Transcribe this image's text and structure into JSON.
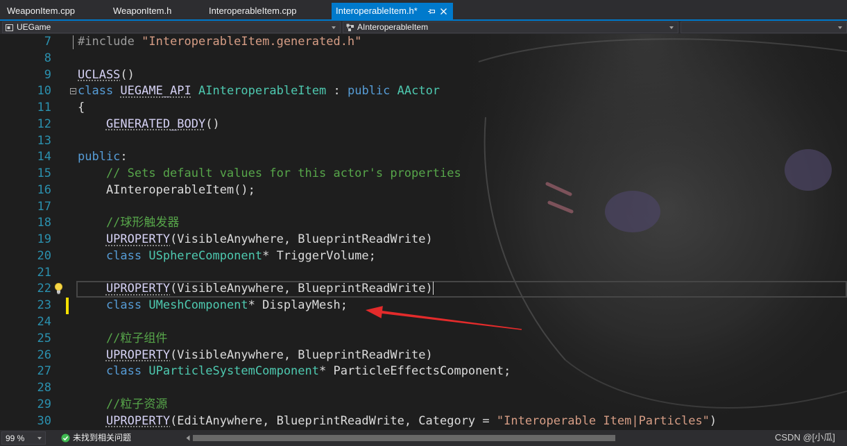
{
  "tabs": [
    {
      "label": "WeaponItem.cpp"
    },
    {
      "label": "WeaponItem.h"
    },
    {
      "label": "InteroperableItem.cpp"
    },
    {
      "label": "InteroperableItem.h*",
      "active": true
    }
  ],
  "nav": {
    "project": "UEGame",
    "scope": "AInteroperableItem"
  },
  "editor": {
    "lines": [
      {
        "number": "7",
        "outline": true,
        "tokens": [
          {
            "text": "#include ",
            "color": "#9b9b9b"
          },
          {
            "text": "\"InteroperableItem.generated.h\"",
            "color": "#d69d85"
          }
        ]
      },
      {
        "number": "8",
        "tokens": []
      },
      {
        "number": "9",
        "tokens": [
          {
            "text": "UCLASS",
            "color": "#d6d2f5",
            "underline": true
          },
          {
            "text": "()",
            "color": "#dcdcdc"
          }
        ]
      },
      {
        "number": "10",
        "collapsible": true,
        "tokens": [
          {
            "text": "class ",
            "color": "#569cd6"
          },
          {
            "text": "UEGAME_API",
            "color": "#d6d2f5",
            "underline": true
          },
          {
            "text": " AInteroperableItem",
            "color": "#4ec9b0"
          },
          {
            "text": " : ",
            "color": "#dcdcdc"
          },
          {
            "text": "public ",
            "color": "#569cd6"
          },
          {
            "text": "AActor",
            "color": "#4ec9b0"
          }
        ]
      },
      {
        "number": "11",
        "tokens": [
          {
            "text": "{",
            "color": "#dcdcdc"
          }
        ]
      },
      {
        "number": "12",
        "indent": 4,
        "tokens": [
          {
            "text": "GENERATED_BODY",
            "color": "#d6d2f5",
            "underline": true
          },
          {
            "text": "()",
            "color": "#dcdcdc"
          }
        ]
      },
      {
        "number": "13",
        "tokens": []
      },
      {
        "number": "14",
        "tokens": [
          {
            "text": "public",
            "color": "#569cd6"
          },
          {
            "text": ":",
            "color": "#dcdcdc"
          }
        ]
      },
      {
        "number": "15",
        "indent": 4,
        "tokens": [
          {
            "text": "// Sets default values for this actor's properties",
            "color": "#57a64a"
          }
        ]
      },
      {
        "number": "16",
        "indent": 4,
        "tokens": [
          {
            "text": "AInteroperableItem();",
            "color": "#dcdcdc"
          }
        ]
      },
      {
        "number": "17",
        "tokens": []
      },
      {
        "number": "18",
        "indent": 4,
        "tokens": [
          {
            "text": "//球形触发器",
            "color": "#57a64a"
          }
        ]
      },
      {
        "number": "19",
        "indent": 4,
        "tokens": [
          {
            "text": "UPROPERTY",
            "color": "#d6d2f5",
            "underline": true
          },
          {
            "text": "(VisibleAnywhere, BlueprintReadWrite)",
            "color": "#dcdcdc"
          }
        ]
      },
      {
        "number": "20",
        "indent": 4,
        "tokens": [
          {
            "text": "class ",
            "color": "#569cd6"
          },
          {
            "text": "USphereComponent",
            "color": "#4ec9b0"
          },
          {
            "text": "* TriggerVolume;",
            "color": "#dcdcdc"
          }
        ]
      },
      {
        "number": "21",
        "tokens": []
      },
      {
        "number": "22",
        "indent": 4,
        "current": true,
        "lightbulb": true,
        "tokens": [
          {
            "text": "UPROPERTY",
            "color": "#d6d2f5",
            "underline": true
          },
          {
            "text": "(VisibleAnywhere, BlueprintReadWrite)",
            "color": "#dcdcdc"
          }
        ]
      },
      {
        "number": "23",
        "indent": 4,
        "modified": true,
        "tokens": [
          {
            "text": "class ",
            "color": "#569cd6"
          },
          {
            "text": "UMeshComponent",
            "color": "#4ec9b0"
          },
          {
            "text": "* DisplayMesh;",
            "color": "#dcdcdc"
          }
        ]
      },
      {
        "number": "24",
        "tokens": []
      },
      {
        "number": "25",
        "indent": 4,
        "tokens": [
          {
            "text": "//粒子组件",
            "color": "#57a64a"
          }
        ]
      },
      {
        "number": "26",
        "indent": 4,
        "tokens": [
          {
            "text": "UPROPERTY",
            "color": "#d6d2f5",
            "underline": true
          },
          {
            "text": "(VisibleAnywhere, BlueprintReadWrite)",
            "color": "#dcdcdc"
          }
        ]
      },
      {
        "number": "27",
        "indent": 4,
        "tokens": [
          {
            "text": "class ",
            "color": "#569cd6"
          },
          {
            "text": "UParticleSystemComponent",
            "color": "#4ec9b0"
          },
          {
            "text": "* ParticleEffectsComponent;",
            "color": "#dcdcdc"
          }
        ]
      },
      {
        "number": "28",
        "tokens": []
      },
      {
        "number": "29",
        "indent": 4,
        "tokens": [
          {
            "text": "//粒子资源",
            "color": "#57a64a"
          }
        ]
      },
      {
        "number": "30",
        "indent": 4,
        "tokens": [
          {
            "text": "UPROPERTY",
            "color": "#d6d2f5",
            "underline": true
          },
          {
            "text": "(EditAnywhere, BlueprintReadWrite, Category = ",
            "color": "#dcdcdc"
          },
          {
            "text": "\"Interoperable Item|Particles\"",
            "color": "#d69d85"
          },
          {
            "text": ")",
            "color": "#dcdcdc"
          }
        ]
      }
    ]
  },
  "status": {
    "zoom": "99 %",
    "issues": "未找到相关问题",
    "watermark": "CSDN @[小瓜]"
  },
  "theme": {
    "accent": "#007acc",
    "line_number": "#2b91af",
    "editor_background": "#1e1e1e",
    "chrome_background": "#2d2d30",
    "modified_marker": "#f5e000",
    "annotation_arrow": "#e32b2b",
    "issues_ok": "#3fb950"
  }
}
